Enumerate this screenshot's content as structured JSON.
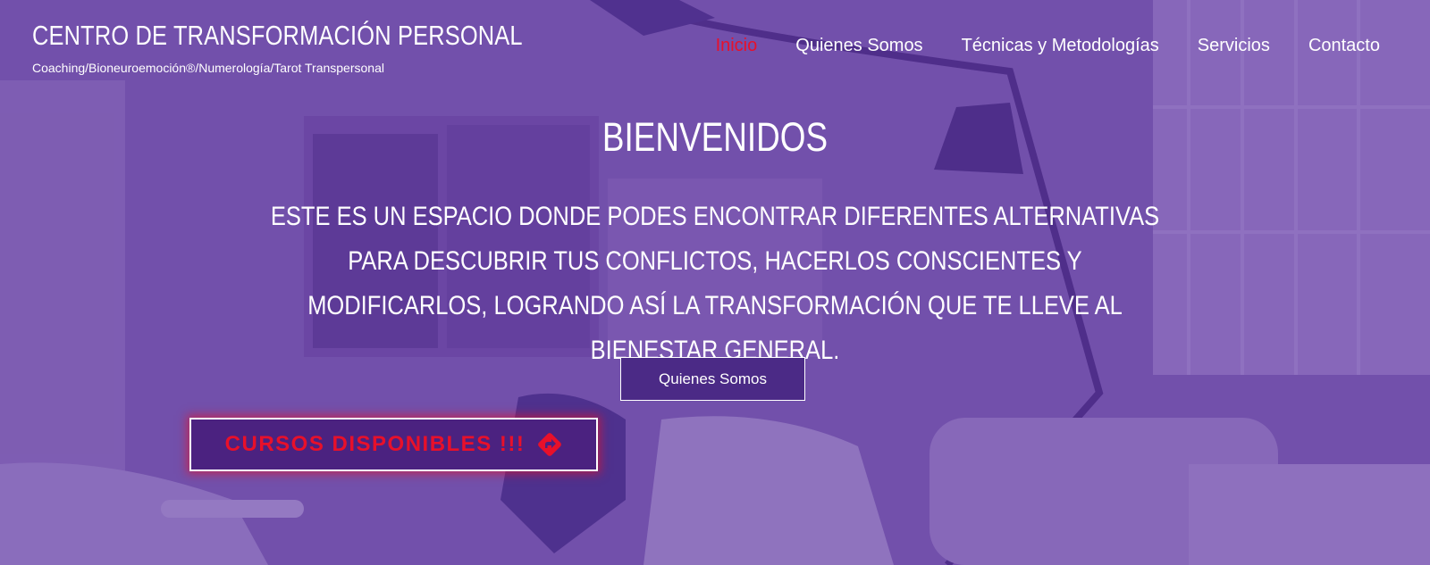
{
  "site": {
    "title": "CENTRO DE TRANSFORMACIÓN PERSONAL",
    "tagline": "Coaching/Bioneuroemoción®/Numerología/Tarot Transpersonal"
  },
  "nav": {
    "items": [
      {
        "label": "Inicio",
        "active": true
      },
      {
        "label": "Quienes Somos"
      },
      {
        "label": "Técnicas y Metodologías"
      },
      {
        "label": "Servicios"
      },
      {
        "label": "Contacto"
      }
    ]
  },
  "hero": {
    "heading": "BIENVENIDOS",
    "text": "ESTE ES UN ESPACIO DONDE PODES ENCONTRAR DIFERENTES ALTERNATIVAS PARA DESCUBRIR TUS CONFLICTOS, HACERLOS CONSCIENTES Y MODIFICARLOS, LOGRANDO ASÍ LA TRANSFORMACIÓN QUE TE LLEVE AL BIENESTAR GENERAL.",
    "about_button": "Quienes Somos",
    "courses_button": "CURSOS DISPONIBLES !!!",
    "courses_icon": "share-arrow-diamond-icon"
  },
  "colors": {
    "overlay": "#5e37a0",
    "active_nav": "#e8102a",
    "button_bg": "#4b2280",
    "accent_red": "#e8102a"
  }
}
